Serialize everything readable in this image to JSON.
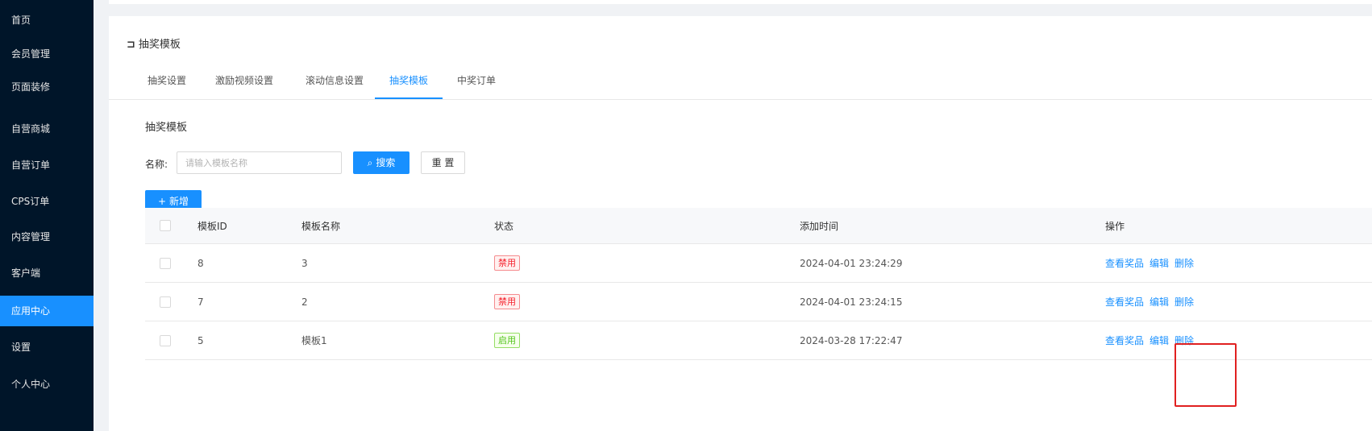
{
  "sidebar": {
    "items": [
      {
        "label": "首页"
      },
      {
        "label": "会员管理"
      },
      {
        "label": "页面装修"
      },
      {
        "label": "自营商城"
      },
      {
        "label": "自营订单"
      },
      {
        "label": "CPS订单"
      },
      {
        "label": "内容管理"
      },
      {
        "label": "客户端"
      },
      {
        "label": "应用中心",
        "active": true
      },
      {
        "label": "设置"
      },
      {
        "label": "个人中心"
      }
    ]
  },
  "page": {
    "title": "抽奖模板",
    "back_icon": "back-bracket-icon"
  },
  "tabs": [
    {
      "label": "抽奖设置"
    },
    {
      "label": "激励视频设置"
    },
    {
      "label": "滚动信息设置"
    },
    {
      "label": "抽奖模板",
      "active": true
    },
    {
      "label": "中奖订单"
    }
  ],
  "section": {
    "title": "抽奖模板"
  },
  "filter": {
    "name_label": "名称:",
    "name_placeholder": "请输入模板名称",
    "search_label": "搜索",
    "reset_label": "重 置",
    "add_label": "新增"
  },
  "table": {
    "columns": {
      "id": "模板ID",
      "name": "模板名称",
      "status": "状态",
      "time": "添加时间",
      "ops": "操作"
    },
    "rows": [
      {
        "id": "8",
        "name": "3",
        "status": "禁用",
        "status_type": "disabled",
        "time": "2024-04-01 23:24:29"
      },
      {
        "id": "7",
        "name": "2",
        "status": "禁用",
        "status_type": "disabled",
        "time": "2024-04-01 23:24:15"
      },
      {
        "id": "5",
        "name": "模板1",
        "status": "启用",
        "status_type": "enabled",
        "time": "2024-03-28 17:22:47"
      }
    ],
    "actions": {
      "view": "查看奖品",
      "edit": "编辑",
      "delete": "删除"
    }
  },
  "colors": {
    "sidebar_bg": "#001529",
    "accent": "#1890ff",
    "disabled_tag": "#f5222d",
    "enabled_tag": "#52c41a",
    "highlight": "#e02020"
  }
}
